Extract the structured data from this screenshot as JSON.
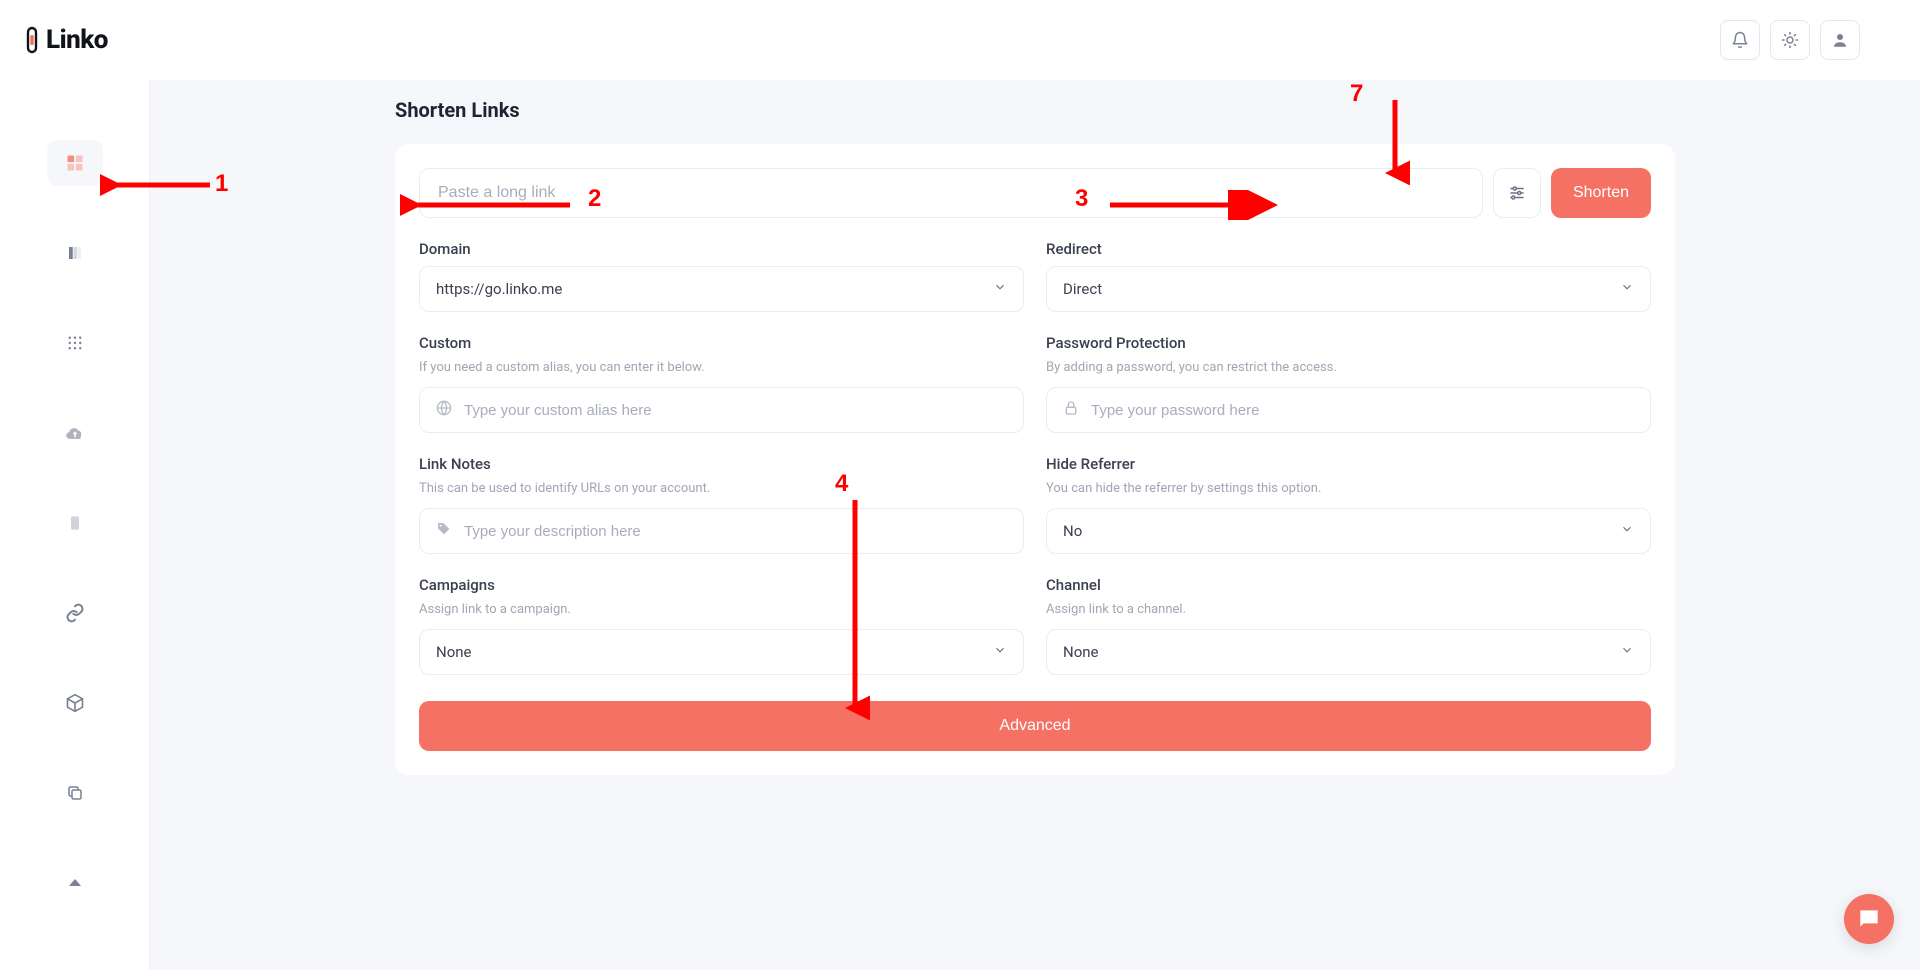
{
  "brand": {
    "name": "Linko"
  },
  "topbar": {
    "notifications_icon": "bell",
    "theme_icon": "sun",
    "user_icon": "user"
  },
  "page": {
    "title": "Shorten Links"
  },
  "shorten_bar": {
    "placeholder": "Paste a long link",
    "settings_icon": "sliders",
    "button": "Shorten"
  },
  "fields": {
    "domain": {
      "label": "Domain",
      "value": "https://go.linko.me"
    },
    "redirect": {
      "label": "Redirect",
      "value": "Direct"
    },
    "custom": {
      "label": "Custom",
      "help": "If you need a custom alias, you can enter it below.",
      "placeholder": "Type your custom alias here"
    },
    "password": {
      "label": "Password Protection",
      "help": "By adding a password, you can restrict the access.",
      "placeholder": "Type your password here"
    },
    "notes": {
      "label": "Link Notes",
      "help": "This can be used to identify URLs on your account.",
      "placeholder": "Type your description here"
    },
    "hide_referrer": {
      "label": "Hide Referrer",
      "help": "You can hide the referrer by settings this option.",
      "value": "No"
    },
    "campaigns": {
      "label": "Campaigns",
      "help": "Assign link to a campaign.",
      "value": "None"
    },
    "channel": {
      "label": "Channel",
      "help": "Assign link to a channel.",
      "value": "None"
    }
  },
  "advanced": {
    "label": "Advanced"
  },
  "annotations": {
    "n1": "1",
    "n2": "2",
    "n3": "3",
    "n4": "4",
    "n7": "7"
  }
}
